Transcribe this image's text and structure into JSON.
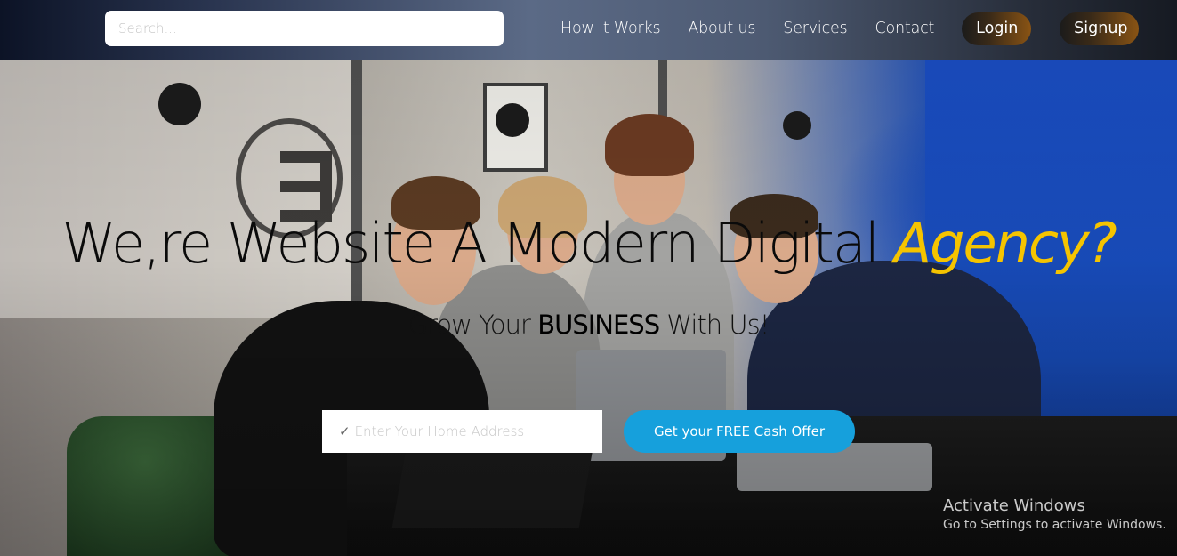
{
  "nav": {
    "search_placeholder": "Search...",
    "links": [
      "How It Works",
      "About us",
      "Services",
      "Contact"
    ],
    "login_label": "Login",
    "signup_label": "Signup"
  },
  "hero": {
    "headline_main": "We,re Website A Modern Digital ",
    "headline_accent": "Agency?",
    "subhead_pre": "Grow Your ",
    "subhead_strong": "BUSINESS",
    "subhead_post": " With Us!",
    "address_check": "✓",
    "address_placeholder": "Enter Your Home Address",
    "cta_label": "Get your FREE Cash Offer"
  },
  "watermark": {
    "title": "Activate Windows",
    "subtitle": "Go to Settings to activate Windows."
  },
  "colors": {
    "accent": "#f5c400",
    "cta": "#16a0dc",
    "pill_gradient_end": "#8a5414"
  },
  "icons": {
    "address_check": "check-icon"
  }
}
